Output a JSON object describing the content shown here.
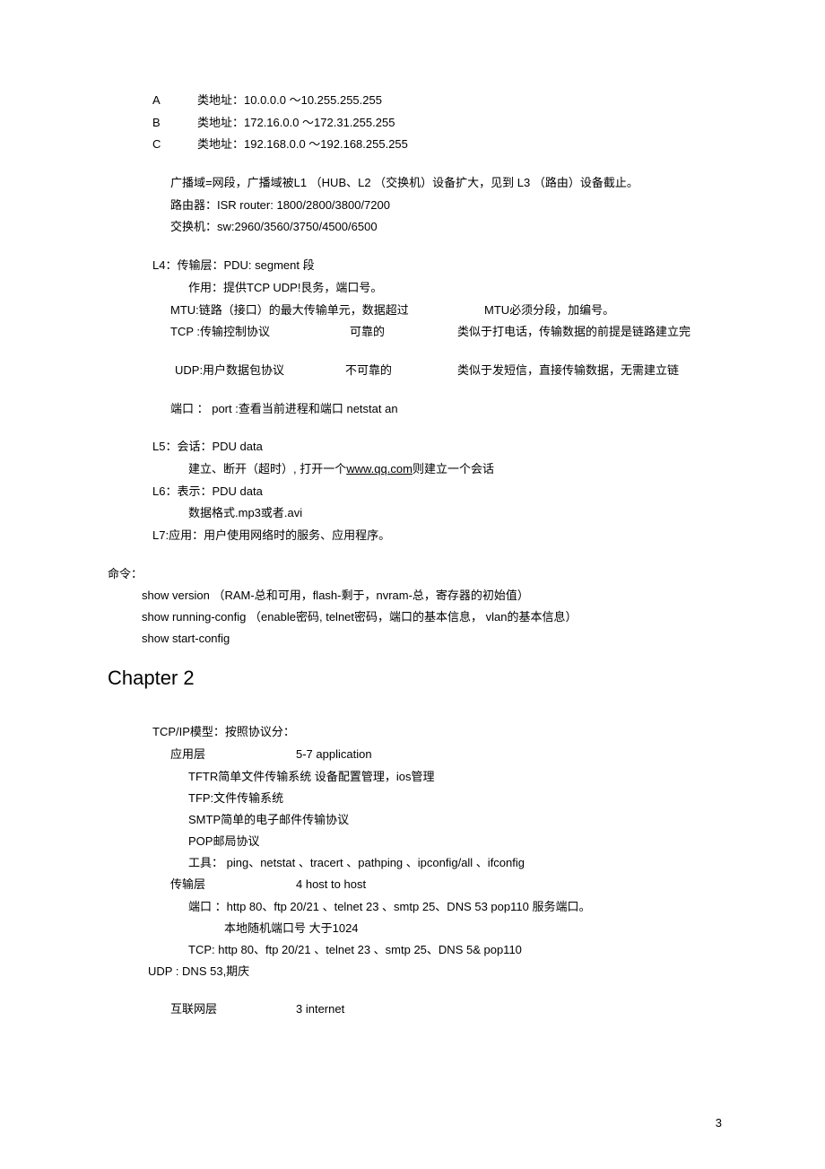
{
  "addr": {
    "a_label": "A",
    "a_text": "类地址：10.0.0.0 ～10.255.255.255",
    "b_label": "B",
    "b_text": "类地址：172.16.0.0    ～172.31.255.255",
    "c_label": "C",
    "c_text": "类地址：192.168.0.0   ～192.168.255.255"
  },
  "broadcast": "广播域=网段，广播域被L1 （HUB、L2 （交换机）设备扩大，见到 L3 （路由）设备截止。",
  "router": "路由器：ISR router:          1800/2800/3800/7200",
  "switch": "交换机：sw:2960/3560/3750/4500/6500",
  "l4_title": "L4：传输层：PDU: segment 段",
  "l4_role": "作用：提供TCP UDP!艮务，端口号。",
  "l4_r1c1": "MTU:链路（接口）的最大传输单元，数据超过",
  "l4_r1c3": "MTU必须分段，加编号。",
  "l4_r2c1": "TCP :传输控制协议",
  "l4_r2c2": "可靠的",
  "l4_r2c3": "类似于打电话，传输数据的前提是链路建立完",
  "l4_r3c1": "UDP:用户数据包协议",
  "l4_r3c2": "不可靠的",
  "l4_r3c3": "类似于发短信，直接传输数据，无需建立链",
  "l4_port": "端口 ：  port :查看当前进程和端口  netstat an",
  "l5_title": "L5：会话：PDU data",
  "l5_line_a": "建立、断开（超时）, 打开一个",
  "l5_link": "www.qq.com",
  "l5_line_b": "则建立一个会话",
  "l6_title": "L6：表示：PDU data",
  "l6_line": "数据格式.mp3或者.avi",
  "l7_title": "L7:应用：用户使用网络时的服务、应用程序。",
  "cmd_title": "命令：",
  "cmd1": "show version （RAM-总和可用，flash-剩于，nvram-总，寄存器的初始值）",
  "cmd2": "show running-config （enable密码, telnet密码，端口的基本信息，      vlan的基本信息）",
  "cmd3": "show start-config",
  "chapter2": "Chapter 2",
  "tcpip_title": "TCP/IP模型：按照协议分：",
  "app_name": "应用层",
  "app_range": "5-7 application",
  "app_l1": "TFTR简单文件传输系统         设备配置管理，ios管理",
  "app_l2": "TFP:文件传输系统",
  "app_l3": "SMTP简单的电子邮件传输协议",
  "app_l4": "POP邮局协议",
  "app_l5": "工具：  ping、netstat 、tracert 、pathping 、ipconfig/all 、ifconfig",
  "trans_name": "传输层",
  "trans_range": "4 host to host",
  "trans_l1": "端口 ：http 80、ftp 20/21 、telnet 23 、smtp 25、DNS 53 pop110 服务端口。",
  "trans_l2": "本地随机端口号 大于1024",
  "trans_l3": "TCP: http 80、ftp 20/21      、telnet 23 、smtp 25、DNS 5& pop110",
  "udp_line": "UDP : DNS 53,期庆",
  "inet_name": "互联网层",
  "inet_range": "3 internet",
  "page": "3"
}
